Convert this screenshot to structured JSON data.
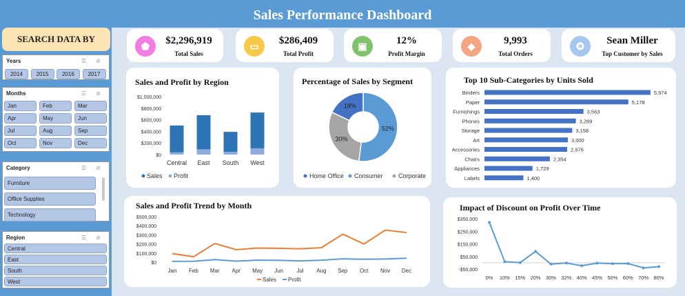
{
  "header": {
    "title": "Sales Performance Dashboard"
  },
  "sidebar": {
    "title": "SEARCH DATA BY",
    "years": {
      "label": "Years",
      "items": [
        "2014",
        "2015",
        "2016",
        "2017"
      ]
    },
    "months": {
      "label": "Months",
      "items": [
        "Jan",
        "Feb",
        "Mar",
        "Apr",
        "May",
        "Jun",
        "Jul",
        "Aug",
        "Sep",
        "Oct",
        "Nov",
        "Dec"
      ]
    },
    "category": {
      "label": "Category",
      "items": [
        "Furniture",
        "Office Supplies",
        "Technology"
      ]
    },
    "region": {
      "label": "Region",
      "items": [
        "Central",
        "East",
        "South",
        "West"
      ]
    }
  },
  "kpis": [
    {
      "value": "$2,296,919",
      "label": "Total Sales",
      "icon": "tag-icon",
      "color": "#f07ce4"
    },
    {
      "value": "$286,409",
      "label": "Total Profit",
      "icon": "money-icon",
      "color": "#f7c948"
    },
    {
      "value": "12%",
      "label": "Profit Margin",
      "icon": "wallet-icon",
      "color": "#7fc26b"
    },
    {
      "value": "9,993",
      "label": "Total Orders",
      "icon": "box-icon",
      "color": "#f4a582"
    },
    {
      "value": "Sean Miller",
      "label": "Top Customer by Sales",
      "icon": "award-icon",
      "color": "#a6c8ee"
    }
  ],
  "colors": {
    "sales": "#2e75b6",
    "profit": "#8faadc",
    "trend_sales": "#ed7d31",
    "trend_profit": "#5b9bd5",
    "discount": "#5b9bd5"
  },
  "chart_data": [
    {
      "type": "bar",
      "title": "Sales and Profit by Region",
      "categories": [
        "Central",
        "East",
        "South",
        "West"
      ],
      "series": [
        {
          "name": "Sales",
          "values": [
            501240,
            678781,
            391722,
            725458
          ]
        },
        {
          "name": "Profit",
          "values": [
            39706,
            91523,
            46749,
            108418
          ]
        }
      ],
      "yticks": [
        "$0",
        "$200,000",
        "$400,000",
        "$600,000",
        "$800,000",
        "$1,000,000"
      ],
      "ylim": [
        0,
        1000000
      ],
      "legend": "bottom"
    },
    {
      "type": "pie",
      "title": "Percentage of Sales by Segment",
      "categories": [
        "Home Office",
        "Consumer",
        "Corporate"
      ],
      "values": [
        18,
        52,
        30
      ],
      "labels": [
        "18%",
        "52%",
        "30%"
      ],
      "legend": "bottom"
    },
    {
      "type": "bar",
      "title": "Top 10 Sub-Categories by Units Sold",
      "categories": [
        "Binders",
        "Paper",
        "Furnishings",
        "Phones",
        "Storage",
        "Art",
        "Accessories",
        "Chairs",
        "Appliances",
        "Labels"
      ],
      "values": [
        5974,
        5178,
        3563,
        3289,
        3158,
        3000,
        2976,
        2354,
        1729,
        1400
      ],
      "labels": [
        "5,974",
        "5,178",
        "3,563",
        "3,289",
        "3,158",
        "3,000",
        "2,976",
        "2,354",
        "1,729",
        "1,400"
      ],
      "orientation": "horizontal"
    },
    {
      "type": "line",
      "title": "Sales and Profit Trend by Month",
      "categories": [
        "Jan",
        "Feb",
        "Mar",
        "Apr",
        "May",
        "Jun",
        "Jul",
        "Aug",
        "Sep",
        "Oct",
        "Nov",
        "Dec"
      ],
      "series": [
        {
          "name": "Sales",
          "values": [
            94925,
            59751,
            205005,
            137762,
            155029,
            152718,
            147238,
            159044,
            307650,
            200323,
            352461,
            325294
          ]
        },
        {
          "name": "Profit",
          "values": [
            9134,
            10294,
            28594,
            11587,
            22411,
            21285,
            13832,
            21776,
            36857,
            31784,
            35468,
            43369
          ]
        }
      ],
      "yticks": [
        "$0",
        "$100,000",
        "$200,000",
        "$300,000",
        "$400,000",
        "$500,000"
      ],
      "ylim": [
        0,
        500000
      ],
      "legend": "bottom"
    },
    {
      "type": "line",
      "title": "Impact of Discount on Profit Over Time",
      "categories": [
        "0%",
        "10%",
        "15%",
        "20%",
        "30%",
        "32%",
        "40%",
        "45%",
        "50%",
        "60%",
        "70%",
        "80%"
      ],
      "values": [
        320988,
        9029,
        1418,
        90338,
        -10369,
        -2391,
        -23057,
        -2493,
        -6613,
        -5944,
        -40075,
        -30539
      ],
      "yticks": [
        "-$50,000",
        "$50,000",
        "$150,000",
        "$250,000",
        "$350,000"
      ],
      "ylim": [
        -50000,
        350000
      ]
    }
  ]
}
